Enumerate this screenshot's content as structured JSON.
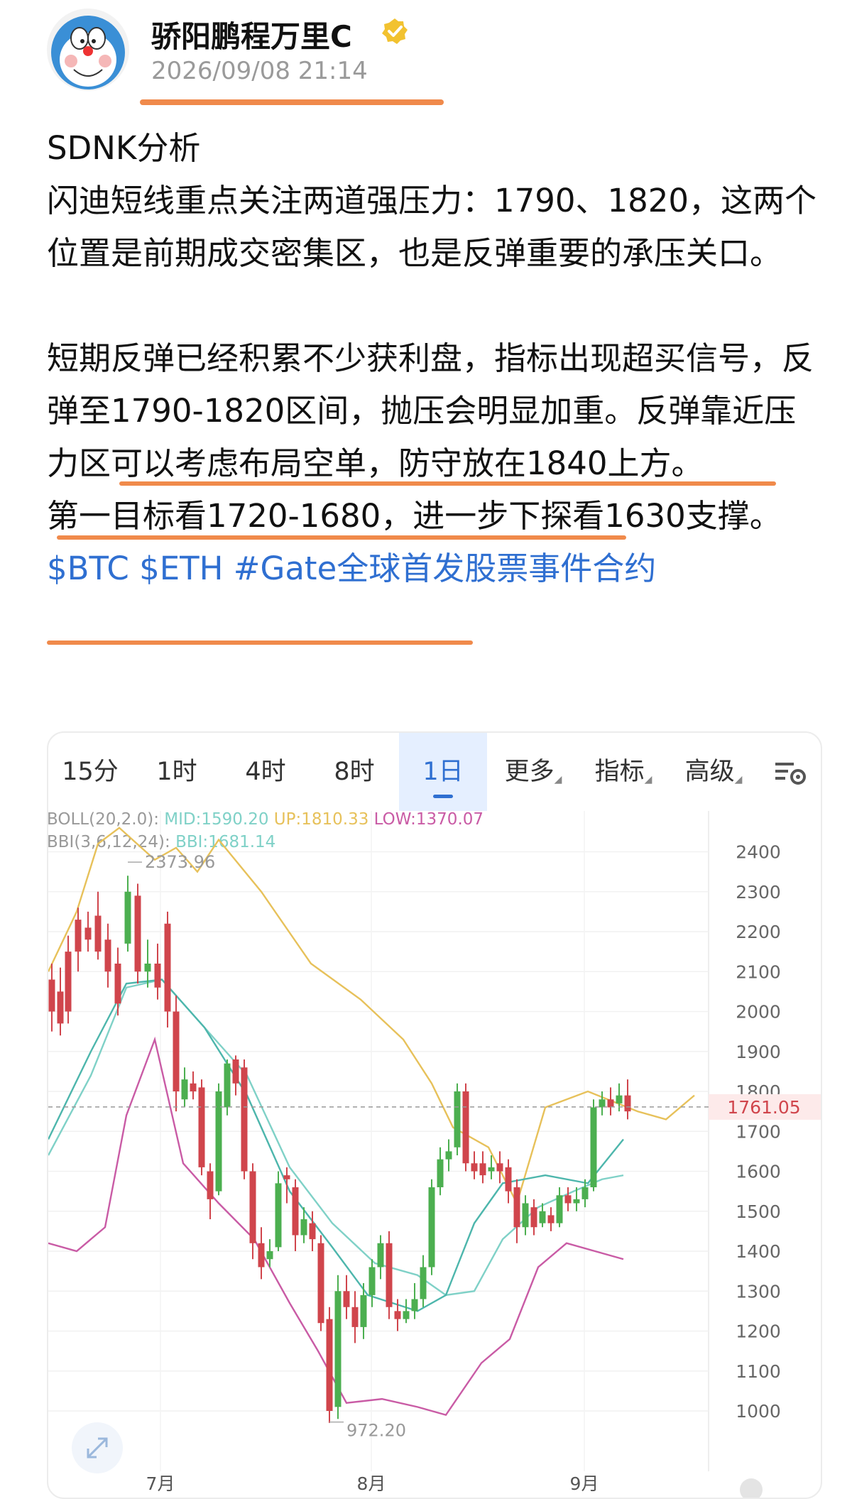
{
  "author": {
    "name": "骄阳鹏程万里C",
    "time": "2026/09/08 21:14",
    "verified_icon": "verified-badge-icon"
  },
  "post": {
    "line1": "SDNK分析",
    "line2": "闪迪短线重点关注两道强压力：1790、1820，这两个位置是前期成交密集区，也是反弹重要的承压关口。",
    "line3": "短期反弹已经积累不少获利盘，指标出现超买信号，反弹至1790-1820区间，抛压会明显加重。反弹靠近压力区可以考虑布局空单，防守放在1840上方。",
    "line4": "第一目标看1720-1680，进一步下探看1630支撑。",
    "tags": "$BTC $ETH #Gate全球首发股票事件合约"
  },
  "tabs": [
    "15分",
    "1时",
    "4时",
    "8时",
    "1日",
    "更多",
    "指标",
    "高级"
  ],
  "active_tab": "1日",
  "indicators": {
    "boll_name": "BOLL(20,2.0):",
    "mid": "MID:1590.20",
    "up": "UP:1810.33",
    "low": "LOW:1370.07",
    "bbi_name": "BBI(3,6,12,24):",
    "bbi": "BBI:1681.14"
  },
  "colors": {
    "up": "#4caf50",
    "down": "#d0454c",
    "mid": "#7fd1c7",
    "upper": "#e7c15a",
    "lower": "#c95ba5",
    "accent": "#2f6fd1"
  },
  "chart_data": {
    "type": "candlestick",
    "y_ticks": [
      1000,
      1100,
      1200,
      1300,
      1400,
      1500,
      1600,
      1700,
      1800,
      1900,
      2000,
      2100,
      2200,
      2300,
      2400
    ],
    "x_labels": [
      "7月",
      "8月",
      "9月"
    ],
    "current_price": "1761.05",
    "max_label": "2373.96",
    "min_label": "972.20",
    "ylim": [
      920,
      2520
    ]
  }
}
